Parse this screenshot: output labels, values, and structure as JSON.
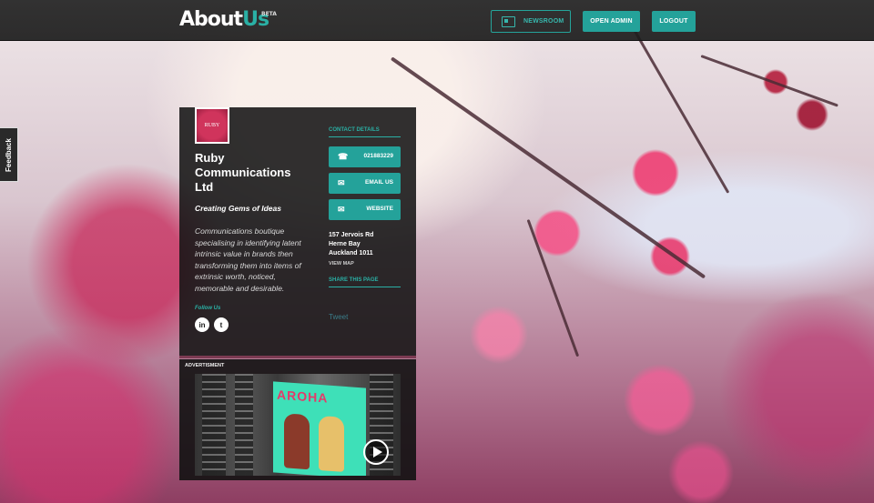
{
  "header": {
    "logo_text": "About",
    "logo_accent": "Us",
    "logo_badge": "BETA",
    "buttons": {
      "newsroom": "NEWSROOM",
      "open_admin": "OPEN ADMIN",
      "logout": "LOGOUT"
    }
  },
  "feedback_tab": "Feedback",
  "profile": {
    "logo_text": "RUBY",
    "company_name": "Ruby Communications Ltd",
    "tagline": "Creating Gems of Ideas",
    "description": "Communications boutique specialising in identifying latent intrinsic value in brands then transforming them into items of extrinsic worth, noticed, memorable and desirable.",
    "follow_label": "Follow Us",
    "social": {
      "linkedin": "in",
      "twitter": "t"
    }
  },
  "contact": {
    "heading": "CONTACT DETAILS",
    "phone": "021883229",
    "email": "EMAIL US",
    "website": "WEBSITE",
    "address_line1": "157 Jervois Rd",
    "address_line2": "Herne Bay",
    "address_line3": "Auckland 1011",
    "view_map": "VIEW MAP",
    "share_heading": "SHARE THIS PAGE",
    "tweet": "Tweet"
  },
  "advertisement": {
    "label": "ADVERTISMENT",
    "poster_text": "AROHA"
  },
  "colors": {
    "accent": "#24a29a",
    "dark_panel": "#141414"
  },
  "icons": [
    "newsroom-icon",
    "phone-icon",
    "email-icon",
    "website-icon",
    "linkedin-icon",
    "twitter-icon",
    "play-icon"
  ]
}
